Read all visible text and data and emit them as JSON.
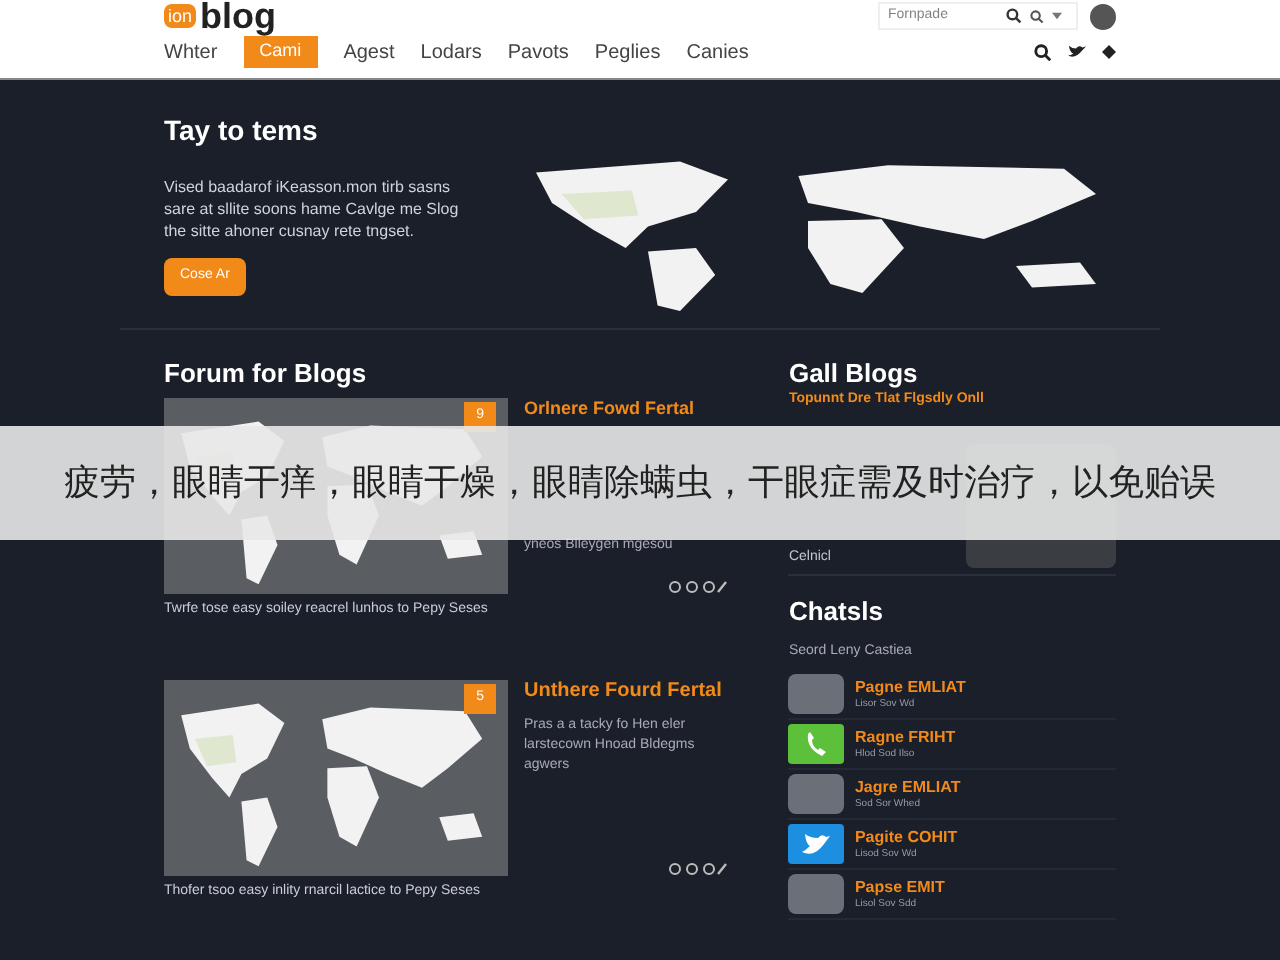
{
  "header": {
    "logo_badge": "ion",
    "logo_text": "blog",
    "search": {
      "placeholder": "Fornpade"
    },
    "nav": [
      {
        "label": "Whter",
        "selected": false
      },
      {
        "label": "Cami",
        "selected": true
      },
      {
        "label": "Agest",
        "selected": false
      },
      {
        "label": "Lodars",
        "selected": false
      },
      {
        "label": "Pavots",
        "selected": false
      },
      {
        "label": "Peglies",
        "selected": false
      },
      {
        "label": "Canies",
        "selected": false
      }
    ]
  },
  "hero": {
    "title": "Tay to tems",
    "text": "Vised baadarof iKeasson.mon tirb sasns sare at sllite soons hame Cavlge me Slog the sitte ahoner cusnay rete tngset.",
    "button": "Cose Ar"
  },
  "forum": {
    "title": "Forum for Blogs",
    "posts": [
      {
        "badge": "9",
        "title": "Orlnere Fowd Fertal",
        "text": "yneos Blleygen mgesou",
        "caption": "Twrfe tose easy soiley reacrel lunhos to Pepy Seses"
      },
      {
        "badge": "5",
        "title": "Unthere Fourd Fertal",
        "text": "Pras a a tacky fo Hen eler larstecown Hnoad Bldegms agwers",
        "caption": "Thofer tsoo easy inlity rnarcil lactice to Pepy Seses"
      }
    ]
  },
  "gall_blogs": {
    "title": "Gall Blogs",
    "headline": "Topunnt Dre Tlat Flgsdly Onll",
    "footer": "Celnicl"
  },
  "chats": {
    "title": "Chatsls",
    "subtitle": "Seord Leny Castiea",
    "items": [
      {
        "kind": "avatar",
        "name": "Pagne EMLIAT",
        "detail": "Lisor Sov Wd"
      },
      {
        "kind": "phone",
        "name": "Ragne FRIHT",
        "detail": "Hlod Sod Ilso"
      },
      {
        "kind": "avatar",
        "name": "Jagre EMLIAT",
        "detail": "Sod Sor Whed"
      },
      {
        "kind": "twitter",
        "name": "Pagite COHIT",
        "detail": "Lisod Sov Wd"
      },
      {
        "kind": "avatar",
        "name": "Papse EMIT",
        "detail": "Lisol Sov Sdd"
      }
    ]
  },
  "overlay_banner": "疲劳，眼睛干痒，眼睛干燥，眼睛除螨虫，干眼症需及时治疗，以免贻误"
}
